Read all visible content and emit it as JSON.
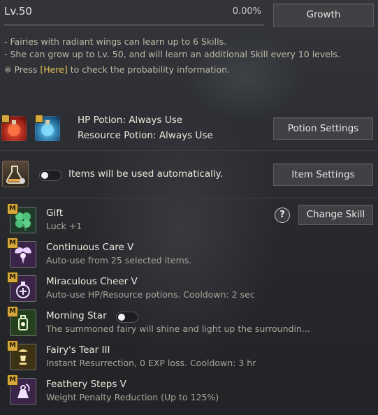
{
  "header": {
    "level": "Lv.50",
    "progress_text": "0.00%",
    "progress_fraction": 0.0,
    "growth_button": "Growth"
  },
  "notes": {
    "line1": "- Fairies with radiant wings can learn up to 6 Skills.",
    "line2": "- She can grow up to Lv. 50, and will learn an additional Skill every 10 levels.",
    "line3_prefix": "※ Press ",
    "line3_link": "[Here]",
    "line3_suffix": " to check the probability information."
  },
  "potion": {
    "hp_label": "HP Potion: Always Use",
    "resource_label": "Resource Potion: Always Use",
    "settings_button": "Potion Settings"
  },
  "items": {
    "auto_label": "Items will be used automatically.",
    "settings_button": "Item Settings"
  },
  "skills_header": {
    "help_symbol": "?",
    "change_button": "Change Skill"
  },
  "skills": [
    {
      "badge": "M",
      "name": "Gift",
      "desc": "Luck +1",
      "icon": "clover-icon",
      "color": "#1f3a28"
    },
    {
      "badge": "M",
      "name": "Continuous Care V",
      "desc": "Auto-use from 25 selected items.",
      "icon": "fairy-icon",
      "color": "#3a2448"
    },
    {
      "badge": "M",
      "name": "Miraculous Cheer V",
      "desc": "Auto-use HP/Resource potions. Cooldown: 2 sec",
      "icon": "potion-cheer-icon",
      "color": "#3a2448"
    },
    {
      "badge": "M",
      "name": "Morning Star",
      "desc": "The summoned fairy will shine and light up the surroundin...",
      "icon": "lantern-icon",
      "color": "#24401e"
    },
    {
      "badge": "M",
      "name": "Fairy's Tear III",
      "desc": "Instant Resurrection, 0 EXP loss. Cooldown: 3 hr",
      "icon": "tear-chalice-icon",
      "color": "#3d3214"
    },
    {
      "badge": "M",
      "name": "Feathery Steps V",
      "desc": "Weight Penalty Reduction (Up to 125%)",
      "icon": "feather-weight-icon",
      "color": "#3a2448"
    }
  ]
}
